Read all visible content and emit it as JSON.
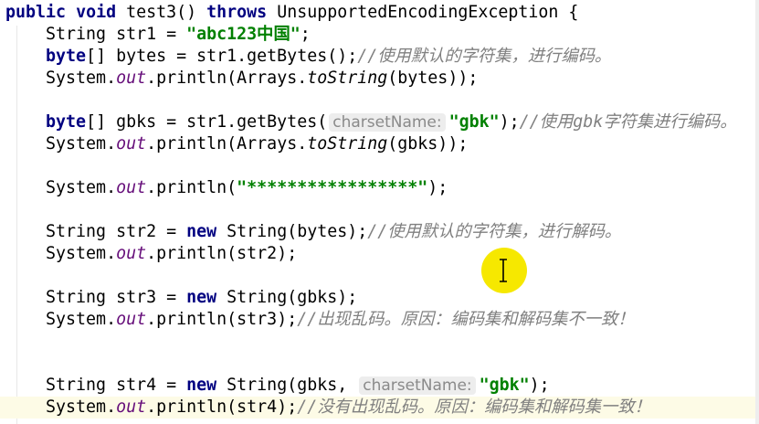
{
  "editor": {
    "lines": [
      {
        "indent": "",
        "tokens": [
          {
            "t": "kw",
            "v": "public"
          },
          {
            "t": "p",
            "v": " "
          },
          {
            "t": "kw",
            "v": "void"
          },
          {
            "t": "p",
            "v": " test3() "
          },
          {
            "t": "kw",
            "v": "throws"
          },
          {
            "t": "p",
            "v": " UnsupportedEncodingException {"
          }
        ]
      },
      {
        "indent": "    ",
        "tokens": [
          {
            "t": "p",
            "v": "String str1 = "
          },
          {
            "t": "str",
            "v": "\"abc123中国\""
          },
          {
            "t": "p",
            "v": ";"
          }
        ]
      },
      {
        "indent": "    ",
        "tokens": [
          {
            "t": "kw",
            "v": "byte"
          },
          {
            "t": "p",
            "v": "[] bytes = str1.getBytes();"
          },
          {
            "t": "comment",
            "v": "//使用默认的字符集，进行编码。"
          }
        ]
      },
      {
        "indent": "    ",
        "tokens": [
          {
            "t": "p",
            "v": "System."
          },
          {
            "t": "field",
            "v": "out"
          },
          {
            "t": "p",
            "v": ".println(Arrays."
          },
          {
            "t": "static",
            "v": "toString"
          },
          {
            "t": "p",
            "v": "(bytes));"
          }
        ]
      },
      {
        "indent": "",
        "tokens": []
      },
      {
        "indent": "    ",
        "tokens": [
          {
            "t": "kw",
            "v": "byte"
          },
          {
            "t": "p",
            "v": "[] gbks = str1.getBytes("
          },
          {
            "t": "hint",
            "v": "charsetName:"
          },
          {
            "t": "str",
            "v": "\"gbk\""
          },
          {
            "t": "p",
            "v": ");"
          },
          {
            "t": "comment",
            "v": "//使用gbk字符集进行编码。"
          }
        ]
      },
      {
        "indent": "    ",
        "tokens": [
          {
            "t": "p",
            "v": "System."
          },
          {
            "t": "field",
            "v": "out"
          },
          {
            "t": "p",
            "v": ".println(Arrays."
          },
          {
            "t": "static",
            "v": "toString"
          },
          {
            "t": "p",
            "v": "(gbks));"
          }
        ]
      },
      {
        "indent": "",
        "tokens": []
      },
      {
        "indent": "    ",
        "tokens": [
          {
            "t": "p",
            "v": "System."
          },
          {
            "t": "field",
            "v": "out"
          },
          {
            "t": "p",
            "v": ".println("
          },
          {
            "t": "str",
            "v": "\"*****************\""
          },
          {
            "t": "p",
            "v": ");"
          }
        ]
      },
      {
        "indent": "",
        "tokens": []
      },
      {
        "indent": "    ",
        "tokens": [
          {
            "t": "p",
            "v": "String str2 = "
          },
          {
            "t": "kw",
            "v": "new"
          },
          {
            "t": "p",
            "v": " String(bytes);"
          },
          {
            "t": "comment",
            "v": "//使用默认的字符集，进行解码。"
          }
        ]
      },
      {
        "indent": "    ",
        "tokens": [
          {
            "t": "p",
            "v": "System."
          },
          {
            "t": "field",
            "v": "out"
          },
          {
            "t": "p",
            "v": ".println(str2);"
          }
        ]
      },
      {
        "indent": "",
        "tokens": []
      },
      {
        "indent": "    ",
        "tokens": [
          {
            "t": "p",
            "v": "String str3 = "
          },
          {
            "t": "kw",
            "v": "new"
          },
          {
            "t": "p",
            "v": " String(gbks);"
          }
        ]
      },
      {
        "indent": "    ",
        "tokens": [
          {
            "t": "p",
            "v": "System."
          },
          {
            "t": "field",
            "v": "out"
          },
          {
            "t": "p",
            "v": ".println(str3);"
          },
          {
            "t": "comment",
            "v": "//出现乱码。原因：编码集和解码集不一致！"
          }
        ]
      },
      {
        "indent": "",
        "tokens": []
      },
      {
        "indent": "",
        "tokens": []
      },
      {
        "indent": "    ",
        "tokens": [
          {
            "t": "p",
            "v": "String str4 = "
          },
          {
            "t": "kw",
            "v": "new"
          },
          {
            "t": "p",
            "v": " String(gbks, "
          },
          {
            "t": "hint",
            "v": "charsetName:"
          },
          {
            "t": "str",
            "v": "\"gbk\""
          },
          {
            "t": "p",
            "v": ");"
          }
        ]
      },
      {
        "indent": "    ",
        "current": true,
        "tokens": [
          {
            "t": "p",
            "v": "System."
          },
          {
            "t": "field",
            "v": "out"
          },
          {
            "t": "p",
            "v": ".println(str4);"
          },
          {
            "t": "comment",
            "v": "//没有出现乱码。原因：编码集和解码集一致！"
          }
        ]
      }
    ]
  }
}
